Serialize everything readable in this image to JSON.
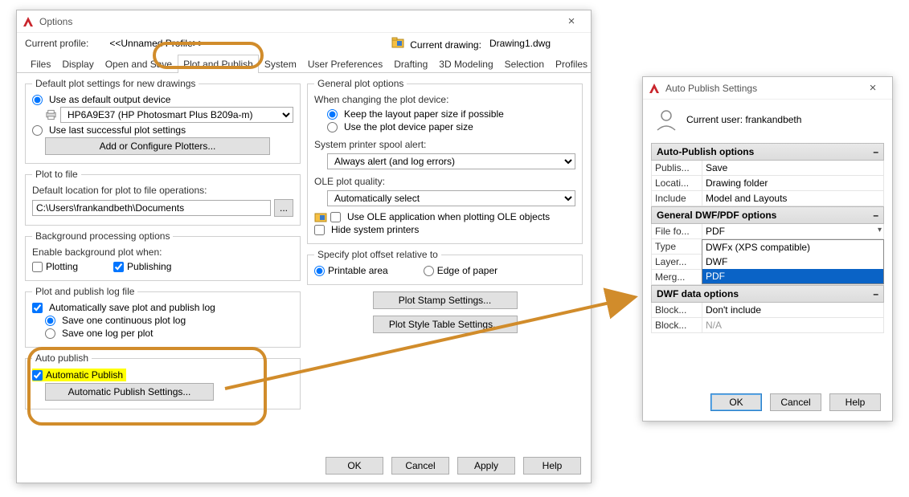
{
  "main": {
    "title": "Options",
    "profile_label": "Current profile:",
    "profile_value": "<<Unnamed Profile>>",
    "drawing_label": "Current drawing:",
    "drawing_value": "Drawing1.dwg",
    "tabs": [
      "Files",
      "Display",
      "Open and Save",
      "Plot and Publish",
      "System",
      "User Preferences",
      "Drafting",
      "3D Modeling",
      "Selection",
      "Profiles"
    ],
    "active_tab": "Plot and Publish",
    "left": {
      "default_plot": {
        "legend": "Default plot settings for new drawings",
        "opt_output": "Use as default output device",
        "device": "HP6A9E37 (HP Photosmart Plus B209a-m)",
        "opt_last": "Use last successful plot settings",
        "btn_plotters": "Add or Configure Plotters..."
      },
      "plot_to_file": {
        "legend": "Plot to file",
        "lbl": "Default location for plot to file operations:",
        "path": "C:\\Users\\frankandbeth\\Documents"
      },
      "bg": {
        "legend": "Background processing options",
        "lbl": "Enable background plot when:",
        "plotting": "Plotting",
        "publishing": "Publishing"
      },
      "log": {
        "legend": "Plot and publish log file",
        "autosave": "Automatically save plot and publish log",
        "one": "Save one continuous plot log",
        "perplot": "Save one log per plot"
      },
      "auto": {
        "legend": "Auto publish",
        "chk": "Automatic Publish",
        "btn": "Automatic Publish Settings..."
      }
    },
    "right": {
      "general": {
        "legend": "General plot options",
        "change_lbl": "When changing the plot device:",
        "keep": "Keep the layout paper size if possible",
        "usedev": "Use the plot device paper size",
        "spool_lbl": "System printer spool alert:",
        "spool_val": "Always alert (and log errors)",
        "ole_lbl": "OLE plot quality:",
        "ole_val": "Automatically select",
        "ole_chk": "Use OLE application when plotting OLE objects",
        "hide": "Hide system printers"
      },
      "offset": {
        "legend": "Specify plot offset relative to",
        "printable": "Printable area",
        "edge": "Edge of paper"
      },
      "btn_stamp": "Plot Stamp Settings...",
      "btn_style": "Plot Style Table Settings..."
    },
    "footer": {
      "ok": "OK",
      "cancel": "Cancel",
      "apply": "Apply",
      "help": "Help"
    }
  },
  "aux": {
    "title": "Auto Publish Settings",
    "user_lbl": "Current user:",
    "user_val": "frankandbeth",
    "sections": {
      "auto": {
        "head": "Auto-Publish options",
        "publish_k": "Publis...",
        "publish_v": "Save",
        "loc_k": "Locati...",
        "loc_v": "Drawing folder",
        "inc_k": "Include",
        "inc_v": "Model and Layouts"
      },
      "general": {
        "head": "General DWF/PDF options",
        "file_k": "File fo...",
        "file_v": "PDF",
        "type_k": "Type",
        "layer_k": "Layer...",
        "merge_k": "Merg...",
        "dd_opts": [
          "DWFx (XPS compatible)",
          "DWF",
          "PDF"
        ],
        "dd_selected": "PDF"
      },
      "dwf": {
        "head": "DWF data options",
        "b1_k": "Block...",
        "b1_v": "Don't include",
        "b2_k": "Block...",
        "b2_v": "N/A"
      }
    },
    "footer": {
      "ok": "OK",
      "cancel": "Cancel",
      "help": "Help"
    }
  }
}
